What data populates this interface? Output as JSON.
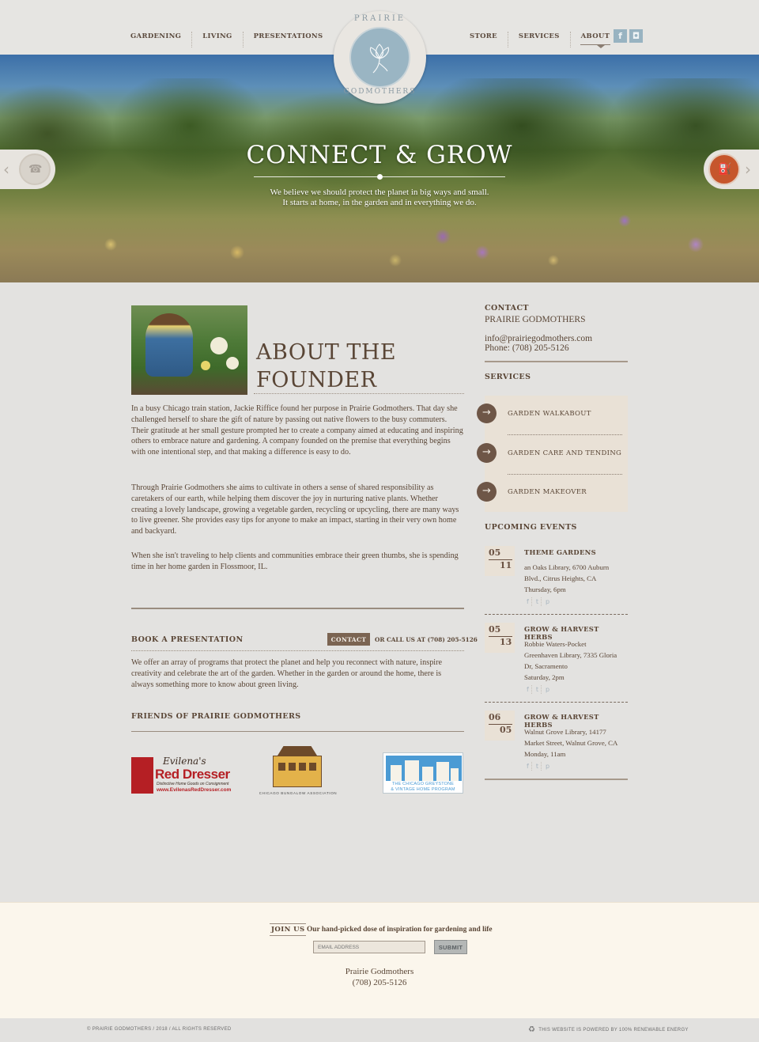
{
  "nav": {
    "left": [
      "GARDENING",
      "LIVING",
      "PRESENTATIONS"
    ],
    "right": [
      "STORE",
      "SERVICES",
      "ABOUT"
    ],
    "active": "ABOUT",
    "social": [
      {
        "icon": "facebook-icon",
        "glyph": "f"
      },
      {
        "icon": "instagram-icon",
        "glyph": "◘"
      }
    ]
  },
  "logo": {
    "top_text": "PRAIRIE",
    "bottom_text": "GODMOTHERS"
  },
  "hero": {
    "title": "CONNECT & GROW",
    "subtitle_line1": "We believe we should protect the planet in big ways and small.",
    "subtitle_line2": "It starts at home, in the garden and in everything we do.",
    "prev_icon": "phone-icon",
    "next_icon": "watering-can-icon"
  },
  "about": {
    "title_line1": "ABOUT THE",
    "title_line2": "FOUNDER",
    "para1": "In a busy Chicago train station, Jackie Riffice found her purpose in Prairie Godmothers. That day she challenged herself to share the gift of nature by passing out native flowers to the busy commuters. Their gratitude at her small gesture prompted her to create a company aimed at educating and inspiring others to embrace nature and gardening. A company founded on the premise that everything begins with one intentional step, and that making a difference is easy to do.",
    "para2": "Through Prairie Godmothers she aims to cultivate in others a sense of shared responsibility as caretakers of our earth, while helping them discover the joy in nurturing native plants. Whether creating a lovely landscape, growing a vegetable garden, recycling or upcycling, there are many ways to live greener. She provides easy tips for anyone to make an impact, starting in their very own home and backyard.",
    "para3": "When she isn't traveling to help clients and communities embrace their green thumbs, she is spending time in her home garden in Flossmoor, IL."
  },
  "book": {
    "title": "BOOK A PRESENTATION",
    "contact_button": "CONTACT",
    "call_text": "OR CALL US AT (708) 205-5126",
    "body": "We offer an array of programs that protect the planet and help you reconnect with nature, inspire creativity and celebrate the art of the garden. Whether in the garden or around the home, there is always something more to know about green living."
  },
  "friends": {
    "title": "FRIENDS OF PRAIRIE GODMOTHERS",
    "red_dresser": {
      "line1": "Evilena's",
      "line2": "Red Dresser",
      "line3": "Distinctive Home Goods on Consignment",
      "line4": "www.EvilenasRedDresser.com"
    },
    "bungalow": {
      "text": "CHICAGO BUNGALOW ASSOCIATION"
    },
    "greystone": {
      "line1": "THE CHICAGO GREYSTONE",
      "line2": "& VINTAGE HOME PROGRAM"
    }
  },
  "sidebar": {
    "contact_heading": "CONTACT",
    "contact_name": "PRAIRIE GODMOTHERS",
    "email": "info@prairiegodmothers.com",
    "phone": "Phone: (708) 205-5126",
    "services_heading": "SERVICES",
    "services": [
      "GARDEN WALKABOUT",
      "GARDEN CARE AND TENDING",
      "GARDEN MAKEOVER"
    ],
    "events_heading": "UPCOMING EVENTS",
    "events": [
      {
        "month": "05",
        "day": "11",
        "title": "THEME GARDENS",
        "line1": "an Oaks Library, 6700 Auburn",
        "line2": "Blvd., Citrus Heights, CA",
        "line3": "Thursday, 6pm"
      },
      {
        "month": "05",
        "day": "13",
        "title": "GROW & HARVEST HERBS",
        "line1": "Robbie Waters-Pocket",
        "line2": "Greenhaven Library, 7335 Gloria",
        "line3": "Dr, Sacramento",
        "line4": "Saturday, 2pm"
      },
      {
        "month": "06",
        "day": "05",
        "title": "GROW & HARVEST HERBS",
        "line1": "Walnut Grove Library, 14177",
        "line2": "Market Street, Walnut Grove, CA",
        "line3": "Monday, 11am"
      }
    ],
    "event_social": [
      "f",
      "t",
      "p"
    ]
  },
  "footer": {
    "join_label": "JOIN US",
    "join_tagline": "Our hand-picked dose of inspiration for gardening and life",
    "email_placeholder": "EMAIL ADDRESS",
    "submit": "SUBMIT",
    "org_name": "Prairie Godmothers",
    "org_phone": "(708) 205-5126",
    "copyright": "© PRAIRIE GODMOTHERS / 2018 / ALL RIGHTS RESERVED",
    "powered": "THIS WEBSITE IS POWERED BY 100% RENEWABLE ENERGY"
  }
}
